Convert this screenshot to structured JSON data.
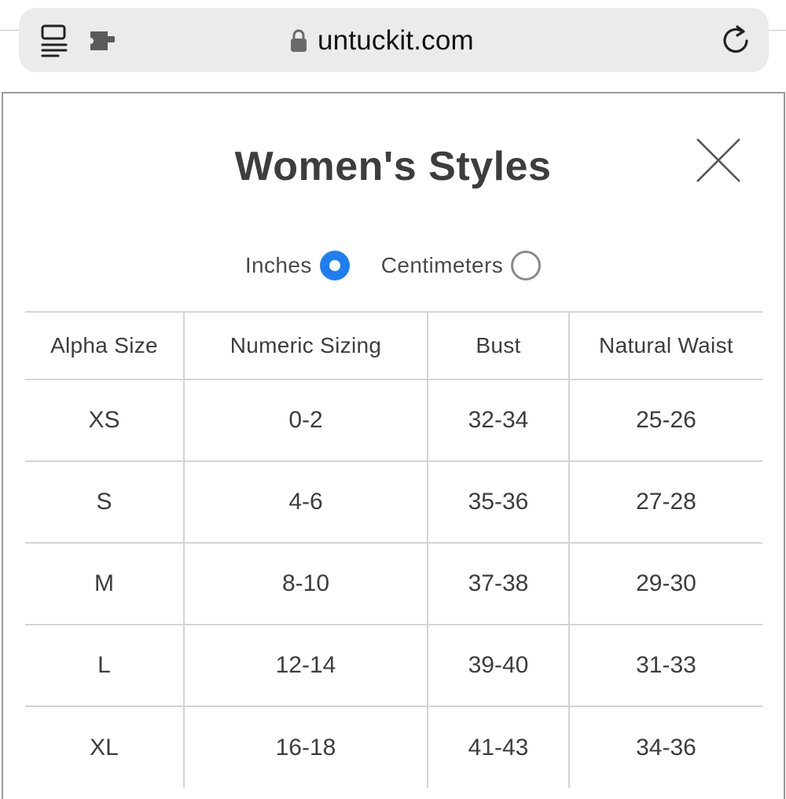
{
  "browser": {
    "url": "untuckit.com",
    "icons": [
      "reader-icon",
      "puzzle-extension-icon",
      "lock-icon",
      "reload-icon"
    ]
  },
  "modal": {
    "title": "Women's Styles",
    "close_icon": "close-x-icon",
    "units": {
      "options": [
        {
          "label": "Inches",
          "selected": true
        },
        {
          "label": "Centimeters",
          "selected": false
        }
      ],
      "accent_color": "#1f7ef0"
    },
    "table": {
      "headers": [
        "Alpha Size",
        "Numeric Sizing",
        "Bust",
        "Natural Waist"
      ],
      "rows": [
        [
          "XS",
          "0-2",
          "32-34",
          "25-26"
        ],
        [
          "S",
          "4-6",
          "35-36",
          "27-28"
        ],
        [
          "M",
          "8-10",
          "37-38",
          "29-30"
        ],
        [
          "L",
          "12-14",
          "39-40",
          "31-33"
        ],
        [
          "XL",
          "16-18",
          "41-43",
          "34-36"
        ]
      ]
    }
  }
}
